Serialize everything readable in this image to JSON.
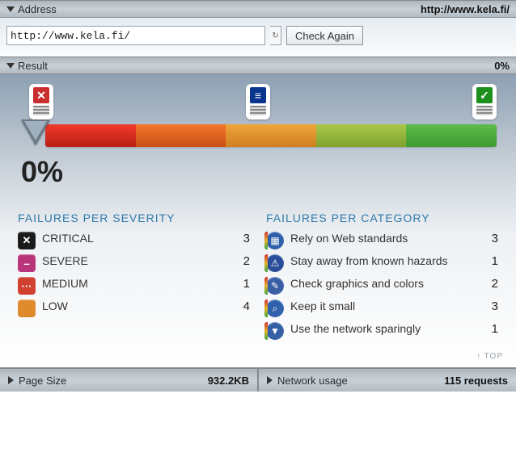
{
  "address": {
    "title": "Address",
    "display_url": "http://www.kela.fi/",
    "input_value": "http://www.kela.fi/",
    "button_label": "Check Again"
  },
  "result": {
    "title": "Result",
    "percent_label": "0%",
    "big_percent": "0%",
    "phones": {
      "red_glyph": "✕",
      "yellow_glyph": "≡",
      "green_glyph": "✓"
    },
    "severity": {
      "heading": "FAILURES PER SEVERITY",
      "items": [
        {
          "label": "CRITICAL",
          "count": "3",
          "glyph": "✕"
        },
        {
          "label": "SEVERE",
          "count": "2",
          "glyph": "–"
        },
        {
          "label": "MEDIUM",
          "count": "1",
          "glyph": "···"
        },
        {
          "label": "LOW",
          "count": "4",
          "glyph": " "
        }
      ]
    },
    "category": {
      "heading": "FAILURES PER CATEGORY",
      "items": [
        {
          "label": "Rely on Web standards",
          "count": "3"
        },
        {
          "label": "Stay away from known hazards",
          "count": "1"
        },
        {
          "label": "Check graphics and colors",
          "count": "2"
        },
        {
          "label": "Keep it small",
          "count": "3"
        },
        {
          "label": "Use the network sparingly",
          "count": "1"
        }
      ]
    },
    "top_link": "↑ TOP"
  },
  "footer": {
    "page_size": {
      "label": "Page Size",
      "value": "932.2KB"
    },
    "network": {
      "label": "Network usage",
      "value": "115 requests"
    }
  }
}
